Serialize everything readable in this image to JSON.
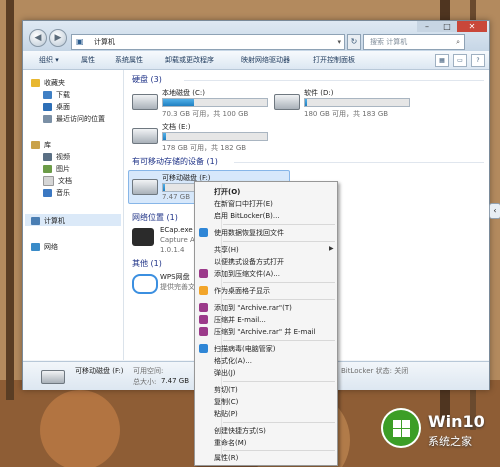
{
  "window": {
    "address": "计算机",
    "search_placeholder": "搜索 计算机",
    "controls": {
      "minimize": "–",
      "maximize": "□",
      "close": "✕"
    }
  },
  "toolbar": {
    "items": [
      "组织 ▾",
      "属性",
      "系统属性",
      "卸载或更改程序",
      "映射网络驱动器",
      "打开控制面板"
    ]
  },
  "nav": {
    "favorites": "收藏夹",
    "favorites_items": [
      "下载",
      "桌面",
      "最近访问的位置"
    ],
    "library": "库",
    "library_items": [
      "视频",
      "图片",
      "文档",
      "音乐"
    ],
    "computer": "计算机",
    "network": "网络"
  },
  "content": {
    "hard_disk_group": "硬盘 (3)",
    "drives": [
      {
        "name": "本地磁盘 (C:)",
        "info": "70.3 GB 可用，共 100 GB",
        "used_fraction": 0.3
      },
      {
        "name": "软件 (D:)",
        "info": "180 GB 可用，共 183 GB",
        "used_fraction": 0.02
      },
      {
        "name": "文档 (E:)",
        "info": "178 GB 可用，共 182 GB",
        "used_fraction": 0.03
      }
    ],
    "removable_group": "有可移动存储的设备 (1)",
    "removable": {
      "name": "可移动磁盘 (F:)",
      "info": "7.47 GB",
      "used_fraction": 0.02
    },
    "network_group": "网络位置 (1)",
    "network_item": {
      "name": "ECap.exe",
      "sub1": "Capture Ap",
      "sub2": "1.0.1.4"
    },
    "other_group": "其他 (1)",
    "other_item": {
      "name": "WPS网盘",
      "sub": "提供完善文"
    }
  },
  "status": {
    "name": "可移动磁盘 (F:)",
    "space_label": "可用空间:",
    "total_label": "总大小:",
    "total_value": "7.47 GB",
    "bitlocker": "BitLocker 状态: 关闭"
  },
  "context_menu": {
    "items": [
      "打开(O)",
      "在新窗口中打开(E)",
      "启用 BitLocker(B)...",
      "使用数据恢复找回文件",
      "共享(H)",
      "以便携式设备方式打开",
      "添加到压缩文件(A)...",
      "作为桌面格子显示",
      "添加到 \"Archive.rar\"(T)",
      "压缩并 E-mail...",
      "压缩到 \"Archive.rar\" 并 E-mail",
      "扫描病毒(电脑管家)",
      "格式化(A)...",
      "弹出(J)",
      "剪切(T)",
      "复制(C)",
      "粘贴(P)",
      "创建快捷方式(S)",
      "重命名(M)",
      "属性(R)"
    ]
  },
  "watermark": {
    "line1": "Win10",
    "line2": "系统之家"
  }
}
